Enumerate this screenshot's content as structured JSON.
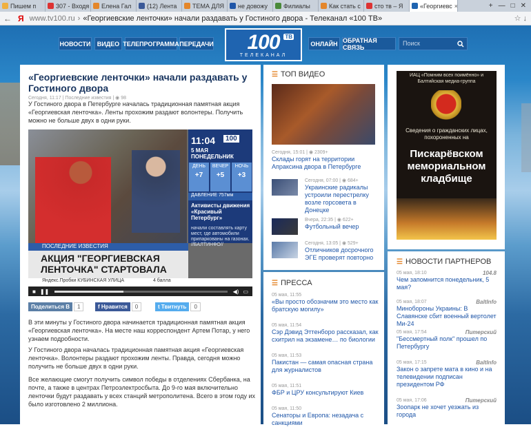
{
  "browser": {
    "tabs": [
      {
        "label": "Пишем п",
        "color": "#f0b040"
      },
      {
        "label": "307 - Входя",
        "color": "#d33"
      },
      {
        "label": "Елена Гал",
        "color": "#e4862a"
      },
      {
        "label": "(12) Лента",
        "color": "#3b5998"
      },
      {
        "label": "ТЕМА ДЛЯ",
        "color": "#e4862a"
      },
      {
        "label": "не довожу",
        "color": "#1f56a8"
      },
      {
        "label": "Филиалы",
        "color": "#4a8a3a"
      },
      {
        "label": "Как стать с",
        "color": "#e4862a"
      },
      {
        "label": "сто тв – Я",
        "color": "#d33"
      },
      {
        "label": "«Георгиевс",
        "color": "#1f64b0"
      }
    ],
    "new_tab": "+",
    "close_tab": "×",
    "minimize": "—",
    "maximize": "□",
    "close": "✕",
    "back": "←",
    "yandex": "Я",
    "domain": "www.tv100.ru",
    "separator": "›",
    "page_title": "«Георгиевские ленточки» начали раздавать у Гостиного двора - Телеканал «100 ТВ»",
    "star": "☆",
    "download": "↓"
  },
  "site": {
    "nav": [
      "НОВОСТИ",
      "ВИДЕО",
      "ТЕЛЕПРОГРАММА",
      "ПЕРЕДАЧИ"
    ],
    "nav_right": [
      "ОНЛАЙН",
      "ОБРАТНАЯ СВЯЗЬ"
    ],
    "logo_num": "100",
    "logo_tv": "ТВ",
    "logo_sub": "ТЕЛЕКАНАЛ",
    "search_placeholder": "Поиск"
  },
  "article": {
    "title": "«Георгиевские ленточки» начали раздавать у Гостиного двора",
    "meta": "Сегодня, 11:17 | Последние известия | ◉ 98",
    "lead": "У Гостиного двора в Петербурге началась традиционная памятная акция «Георгиевская ленточка». Ленты прохожим раздают волонтеры. Получить можно не больше двух в одни руки.",
    "paragraphs": [
      "В эти минуты у Гостиного двора начинается традиционная памятная акция «Георгиевская ленточка». На месте наш корреспондент Артем Потар, у него узнаем подробности.",
      "У Гостиного двора началась традиционная памятная акция «Георгиевская ленточка». Волонтеры раздают прохожим ленты. Правда, сегодня можно получить не больше двух в одни руки.",
      "Все желающие смогут получить символ победы в отделениях Сбербанка, на почте, а также в центрах Петроэлектросбыта. До 9-го мая включительно ленточки будут раздавать у всех станций метрополитена. Всего в этом году их было изготовлено 2 миллиона."
    ],
    "share": [
      {
        "label": "Поделиться",
        "icon": "В",
        "count": "1",
        "color": "#5b7fa6"
      },
      {
        "label": "Нравится",
        "icon": "f",
        "count": "0",
        "color": "#3b5998"
      },
      {
        "label": "Твитнуть",
        "icon": "t",
        "count": "0",
        "color": "#55acee"
      }
    ]
  },
  "video": {
    "time": "11:04",
    "logo": "100",
    "date_day": "5",
    "date_month": "МАЯ",
    "weekday": "ПОНЕДЕЛЬНИК",
    "weather": [
      {
        "label": "ДЕНЬ",
        "value": "+7"
      },
      {
        "label": "ВЕЧЕР",
        "value": "+5"
      },
      {
        "label": "НОЧЬ",
        "value": "+3"
      }
    ],
    "pressure": "ДАВЛЕНИЕ 757мм",
    "activists": "Активисты движения «Красивый Петербург»",
    "ticker": "начали составлять карту мест, где автомобили припаркованы на газонах. //БАЛТИНФО//",
    "section": "ПОСЛЕДНИЕ ИЗВЕСТИЯ",
    "headline": "АКЦИЯ \"ГЕОРГИЕВСКАЯ ЛЕНТОЧКА\" СТАРТОВАЛА",
    "traffic": "Яндекс.Пробки   КУБИНСКАЯ УЛИЦА",
    "traffic_score": "4 балла",
    "progress": 0.4
  },
  "top_video": {
    "heading": "ТОП ВИДЕО",
    "main_meta": "Сегодня, 15:01 | ◉ 2309+",
    "main_title": "Склады горят на территории Апраксина двора в Петербурге",
    "items": [
      {
        "meta": "Сегодня, 07:00 | ◉ 684+",
        "title": "Украинские радикалы устроили перестрелку возле горсовета в Донецке"
      },
      {
        "meta": "Вчера, 22:35 | ◉ 622+",
        "title": "Футбольный вечер"
      },
      {
        "meta": "Сегодня, 13:05 | ◉ 529+",
        "title": "Отличников досрочного ЭГЕ проверят повторно"
      }
    ]
  },
  "press": {
    "heading": "ПРЕССА",
    "items": [
      {
        "meta": "05 мая, 11:55",
        "title": "«Вы просто обозначим это место как братскую могилу»"
      },
      {
        "meta": "05 мая, 11:54",
        "title": "Сэр Дэвид Эттенборо рассказал, как схитрил на экзамене… по биологии"
      },
      {
        "meta": "05 мая, 11:53",
        "title": "Пакистан — самая опасная страна для журналистов"
      },
      {
        "meta": "05 мая, 11:51",
        "title": "ФБР и ЦРУ консультируют Киев"
      },
      {
        "meta": "05 мая, 11:50",
        "title": "Сенаторы и Европа: незадача с санкциями"
      }
    ]
  },
  "ad": {
    "top": "ИАЦ «Помним всех поимённо» и Балтийская медиа-группа",
    "text": "Сведения о гражданских лицах, похороненных на",
    "big": "Пискарёвском мемориальном кладбище"
  },
  "partners": {
    "heading": "НОВОСТИ ПАРТНЕРОВ",
    "items": [
      {
        "meta": "05 мая, 18:10",
        "src": "104.8",
        "title": "Чем запомнится понедельник, 5 мая?"
      },
      {
        "meta": "05 мая, 18:07",
        "src": "BaltInfo",
        "title": "Минобороны Украины: В Славянске сбит военный вертолет Ми-24"
      },
      {
        "meta": "05 мая, 17:54",
        "src": "Питерский",
        "title": "\"Бессмертный полк\" прошел по Петербургу"
      },
      {
        "meta": "05 мая, 17:15",
        "src": "BaltInfo",
        "title": "Закон о запрете мата в кино и на телевидении подписан президентом РФ"
      },
      {
        "meta": "05 мая, 17:06",
        "src": "Питерский",
        "title": "Зоопарк не хочет уезжать из города"
      }
    ]
  },
  "colors": {
    "accent": "#1f56a8",
    "nav_bg": "#1a5a9c",
    "section_mark": "#e4862a"
  }
}
